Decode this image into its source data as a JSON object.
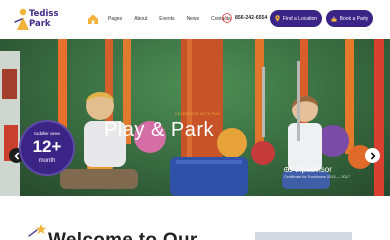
{
  "header": {
    "logo": {
      "line1": "Tediss",
      "line2": "Park"
    },
    "nav": [
      "Pages",
      "About",
      "Events",
      "News",
      "Contacts"
    ],
    "phone": "856-242-6554",
    "find_location": "Find a Location",
    "book_party": "Book a Party"
  },
  "hero": {
    "kicker": "CELEBRATE WITH FUN",
    "title": "Play & Park",
    "badge": {
      "top": "toddler area",
      "big": "12+",
      "bottom": "month"
    },
    "tripadvisor": {
      "name": "tripadvisor",
      "sub": "Certificate for Excellence 2013 — 2017"
    }
  },
  "welcome": {
    "title": "Welcome to Our"
  },
  "colors": {
    "brand": "#3a2486",
    "accent": "#f0b030",
    "hero_green": "#3b6f43"
  },
  "icons": [
    "home-icon",
    "phone-icon",
    "location-pin-icon",
    "cake-icon",
    "chevron-left-icon",
    "chevron-right-icon",
    "owl-icon",
    "star-icon"
  ]
}
